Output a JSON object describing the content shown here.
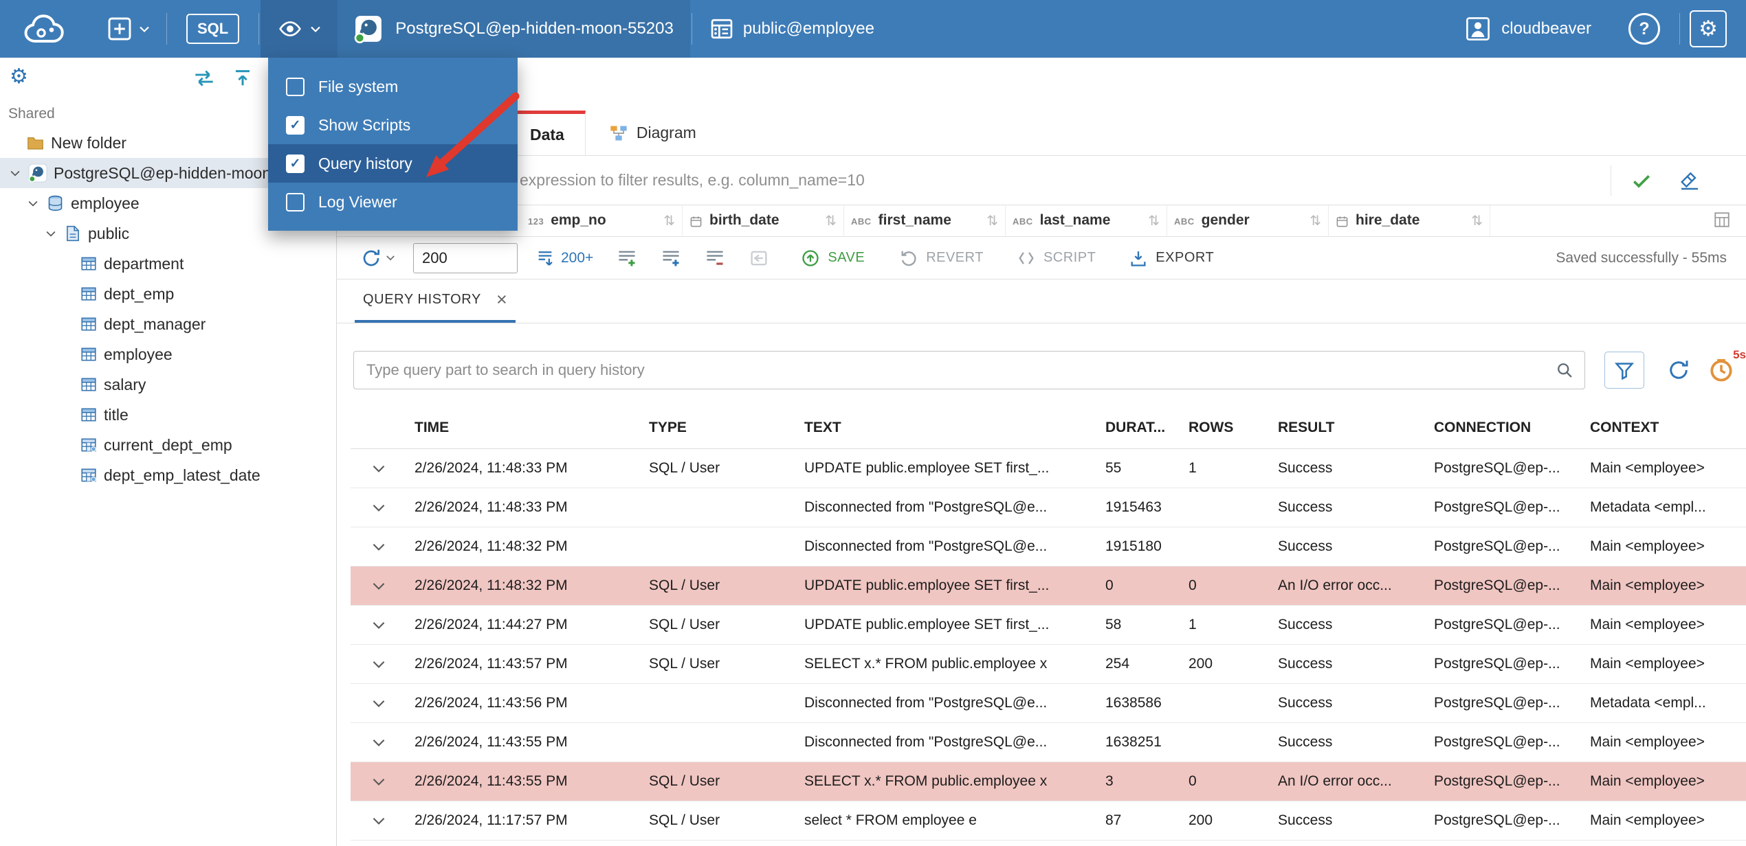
{
  "colors": {
    "topbar_bg": "#3E7CB7",
    "tool_active_bg": "#34699F",
    "menu_highlight": "#2C5F98",
    "accent_blue": "#2E74B5",
    "tab_active_red": "#E23C3C",
    "save_green": "#3F9D44",
    "error_row_bg": "#F0C6C2",
    "arrow_red": "#E0382C",
    "status_green_dot": "#3FA142",
    "tree_selected_bg": "#E2E8EF"
  },
  "icons": {
    "close": "×",
    "gear": "⚙",
    "sort": "⇅",
    "check": "✓"
  },
  "topbar": {
    "sql_label": "SQL",
    "connection": {
      "name": "PostgreSQL@ep-hidden-moon-55203"
    },
    "schema": {
      "name": "public@employee"
    },
    "user": {
      "name": "cloudbeaver"
    },
    "help": "?"
  },
  "view_menu": {
    "items": [
      {
        "label": "File system",
        "checked": false,
        "highlighted": false
      },
      {
        "label": "Show Scripts",
        "checked": true,
        "highlighted": false
      },
      {
        "label": "Query history",
        "checked": true,
        "highlighted": true
      },
      {
        "label": "Log Viewer",
        "checked": false,
        "highlighted": false
      }
    ]
  },
  "sidebar": {
    "section_label": "Shared",
    "tree": [
      {
        "label": "New folder",
        "icon": "folder",
        "level": 0,
        "chevron": false,
        "selected": false
      },
      {
        "label": "PostgreSQL@ep-hidden-moon-55203",
        "icon": "postgres",
        "level": 0,
        "chevron": true,
        "selected": true
      },
      {
        "label": "employee",
        "icon": "database",
        "level": 1,
        "chevron": true,
        "selected": false
      },
      {
        "label": "public",
        "icon": "schema",
        "level": 2,
        "chevron": true,
        "selected": false
      },
      {
        "label": "department",
        "icon": "table",
        "level": 3,
        "chevron": false,
        "selected": false
      },
      {
        "label": "dept_emp",
        "icon": "table",
        "level": 3,
        "chevron": false,
        "selected": false
      },
      {
        "label": "dept_manager",
        "icon": "table",
        "level": 3,
        "chevron": false,
        "selected": false
      },
      {
        "label": "employee",
        "icon": "table",
        "level": 3,
        "chevron": false,
        "selected": false
      },
      {
        "label": "salary",
        "icon": "table",
        "level": 3,
        "chevron": false,
        "selected": false
      },
      {
        "label": "title",
        "icon": "table",
        "level": 3,
        "chevron": false,
        "selected": false
      },
      {
        "label": "current_dept_emp",
        "icon": "view",
        "level": 3,
        "chevron": false,
        "selected": false
      },
      {
        "label": "dept_emp_latest_date",
        "icon": "view",
        "level": 3,
        "chevron": false,
        "selected": false
      }
    ]
  },
  "editor": {
    "tabs": [
      {
        "label": "Data",
        "active": true
      },
      {
        "label": "Diagram",
        "active": false
      }
    ],
    "filter_placeholder": "expression to filter results, e.g. column_name=10",
    "grid_columns": [
      {
        "name": "emp_no",
        "type": "123"
      },
      {
        "name": "birth_date",
        "type": "date"
      },
      {
        "name": "first_name",
        "type": "ABC"
      },
      {
        "name": "last_name",
        "type": "ABC"
      },
      {
        "name": "gender",
        "type": "ABC"
      },
      {
        "name": "hire_date",
        "type": "date"
      }
    ],
    "toolbar": {
      "row_limit": "200",
      "fetch_label": "200+",
      "save_label": "SAVE",
      "revert_label": "REVERT",
      "script_label": "SCRIPT",
      "export_label": "EXPORT",
      "status": "Saved successfully - 55ms"
    }
  },
  "history": {
    "tab_label": "QUERY HISTORY",
    "search_placeholder": "Type query part to search in query history",
    "refresh_badge": "5s",
    "columns": [
      "TIME",
      "TYPE",
      "TEXT",
      "DURAT...",
      "ROWS",
      "RESULT",
      "CONNECTION",
      "CONTEXT"
    ],
    "rows": [
      {
        "time": "2/26/2024, 11:48:33 PM",
        "type": "SQL / User",
        "text": "UPDATE public.employee SET first_...",
        "duration": "55",
        "rows": "1",
        "result": "Success",
        "connection": "PostgreSQL@ep-...",
        "context": "Main <employee>",
        "error": false
      },
      {
        "time": "2/26/2024, 11:48:33 PM",
        "type": "",
        "text": "Disconnected from \"PostgreSQL@e...",
        "duration": "1915463",
        "rows": "",
        "result": "Success",
        "connection": "PostgreSQL@ep-...",
        "context": "Metadata <empl...",
        "error": false
      },
      {
        "time": "2/26/2024, 11:48:32 PM",
        "type": "",
        "text": "Disconnected from \"PostgreSQL@e...",
        "duration": "1915180",
        "rows": "",
        "result": "Success",
        "connection": "PostgreSQL@ep-...",
        "context": "Main <employee>",
        "error": false
      },
      {
        "time": "2/26/2024, 11:48:32 PM",
        "type": "SQL / User",
        "text": "UPDATE public.employee SET first_...",
        "duration": "0",
        "rows": "0",
        "result": "An I/O error occ...",
        "connection": "PostgreSQL@ep-...",
        "context": "Main <employee>",
        "error": true
      },
      {
        "time": "2/26/2024, 11:44:27 PM",
        "type": "SQL / User",
        "text": "UPDATE public.employee SET first_...",
        "duration": "58",
        "rows": "1",
        "result": "Success",
        "connection": "PostgreSQL@ep-...",
        "context": "Main <employee>",
        "error": false
      },
      {
        "time": "2/26/2024, 11:43:57 PM",
        "type": "SQL / User",
        "text": "SELECT x.* FROM public.employee x",
        "duration": "254",
        "rows": "200",
        "result": "Success",
        "connection": "PostgreSQL@ep-...",
        "context": "Main <employee>",
        "error": false
      },
      {
        "time": "2/26/2024, 11:43:56 PM",
        "type": "",
        "text": "Disconnected from \"PostgreSQL@e...",
        "duration": "1638586",
        "rows": "",
        "result": "Success",
        "connection": "PostgreSQL@ep-...",
        "context": "Metadata <empl...",
        "error": false
      },
      {
        "time": "2/26/2024, 11:43:55 PM",
        "type": "",
        "text": "Disconnected from \"PostgreSQL@e...",
        "duration": "1638251",
        "rows": "",
        "result": "Success",
        "connection": "PostgreSQL@ep-...",
        "context": "Main <employee>",
        "error": false
      },
      {
        "time": "2/26/2024, 11:43:55 PM",
        "type": "SQL / User",
        "text": "SELECT x.* FROM public.employee x",
        "duration": "3",
        "rows": "0",
        "result": "An I/O error occ...",
        "connection": "PostgreSQL@ep-...",
        "context": "Main <employee>",
        "error": true
      },
      {
        "time": "2/26/2024, 11:17:57 PM",
        "type": "SQL / User",
        "text": "select * FROM employee e",
        "duration": "87",
        "rows": "200",
        "result": "Success",
        "connection": "PostgreSQL@ep-...",
        "context": "Main <employee>",
        "error": false
      }
    ]
  }
}
